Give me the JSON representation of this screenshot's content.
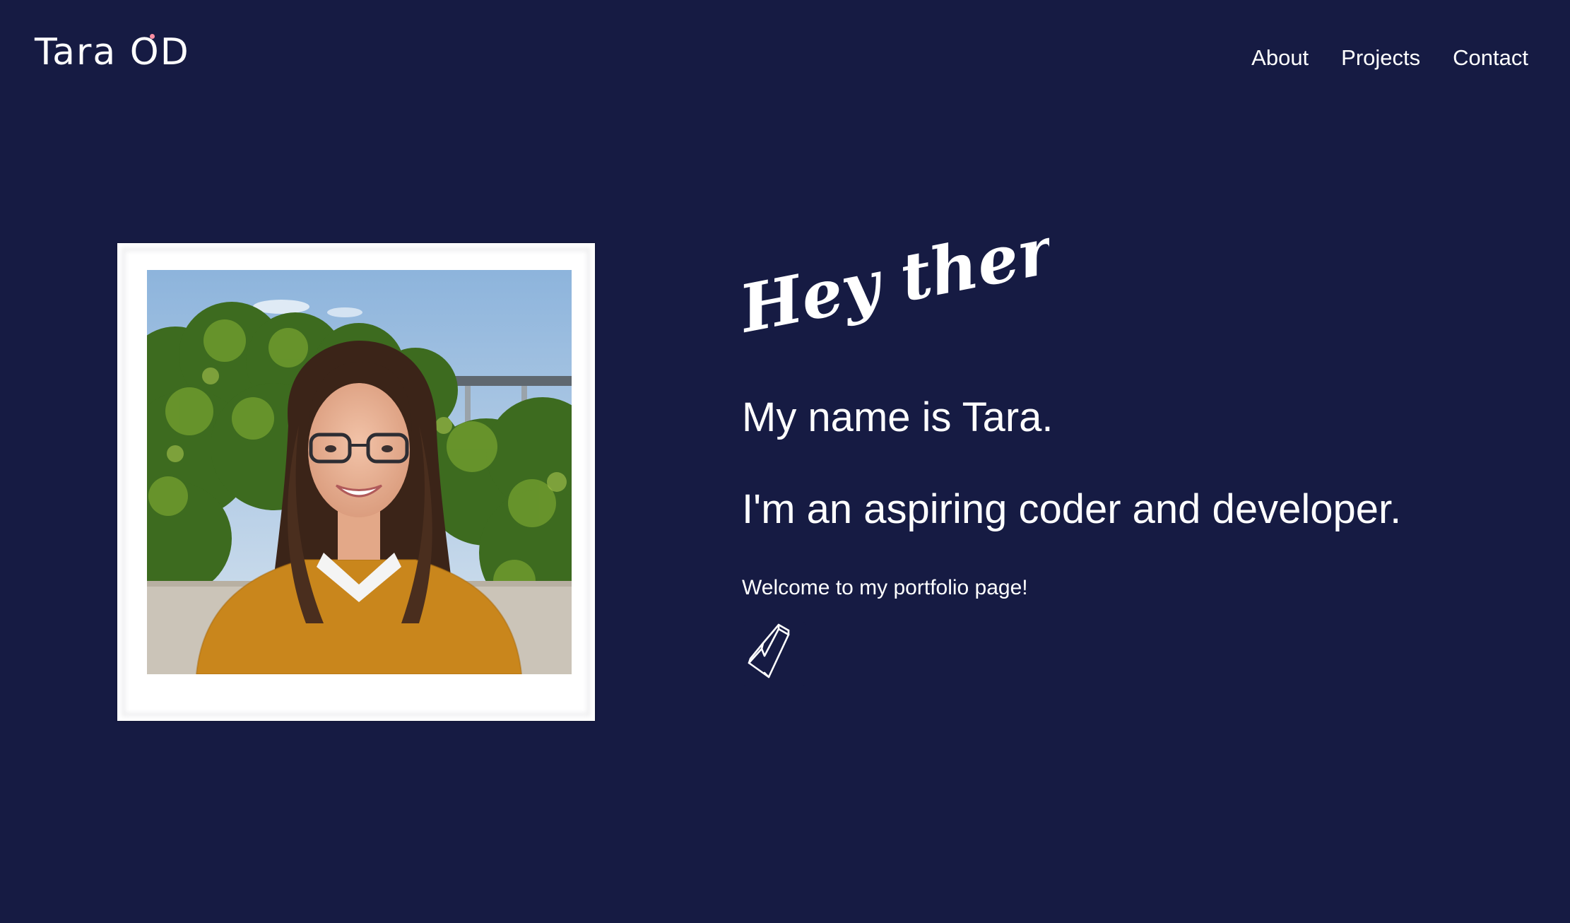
{
  "header": {
    "logo_text": "Tara OD",
    "nav": [
      {
        "label": "About"
      },
      {
        "label": "Projects"
      },
      {
        "label": "Contact"
      }
    ]
  },
  "hero": {
    "greeting": "Hey there!",
    "name_line": "My name is Tara.",
    "role_line": "I'm an aspiring coder and developer.",
    "welcome_line": "Welcome to my portfolio page!",
    "scroll_icon": "hand-drawn-arrow-down-icon",
    "photo_alt": "Photo of Tara smiling, wearing glasses and a mustard sweater in front of green shrubs"
  },
  "colors": {
    "background": "#161b43",
    "text": "#ffffff",
    "polaroid_frame": "#ffffff",
    "logo_accent": "#ff8fa3"
  }
}
